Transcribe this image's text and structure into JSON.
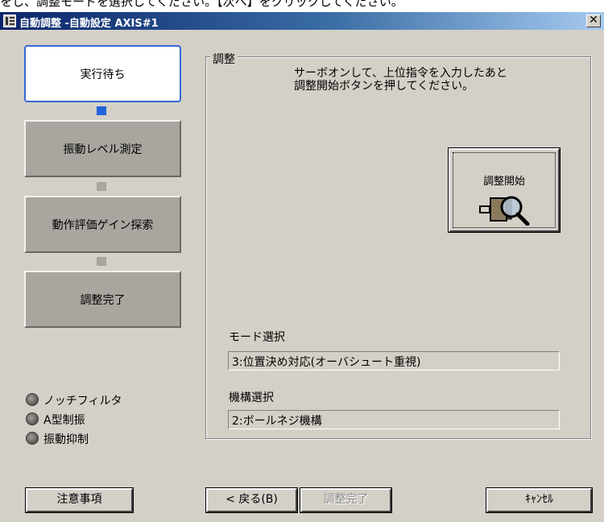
{
  "top_strip_text": "をし、調整モードを選択してください。【次へ】をクリックしてください。",
  "window": {
    "title": "自動調整 -自動設定 AXIS#1",
    "close_glyph": "✕"
  },
  "steps": [
    {
      "label": "実行待ち",
      "active": true
    },
    {
      "label": "振動レベル測定",
      "active": false
    },
    {
      "label": "動作評価ゲイン探索",
      "active": false
    },
    {
      "label": "調整完了",
      "active": false
    }
  ],
  "indicators": [
    {
      "label": "ノッチフィルタ"
    },
    {
      "label": "A型制振"
    },
    {
      "label": "振動抑制"
    }
  ],
  "group": {
    "legend": "調整",
    "instruction_line1": "サーボオンして、上位指令を入力したあと",
    "instruction_line2": "調整開始ボタンを押してください。",
    "start_button_label": "調整開始",
    "mode_label": "モード選択",
    "mode_value": "3:位置決め対応(オーバシュート重視)",
    "mechanism_label": "機構選択",
    "mechanism_value": "2:ボールネジ機構"
  },
  "buttons": {
    "notes": "注意事項",
    "back": "< 戻る(B)",
    "finish": "調整完了",
    "cancel": "ｷｬﾝｾﾙ"
  },
  "colors": {
    "titlebar_start": "#0a246a",
    "active_step_border": "#3867d6",
    "active_connector": "#2264d8",
    "dialog_face": "#d4d0c8"
  }
}
